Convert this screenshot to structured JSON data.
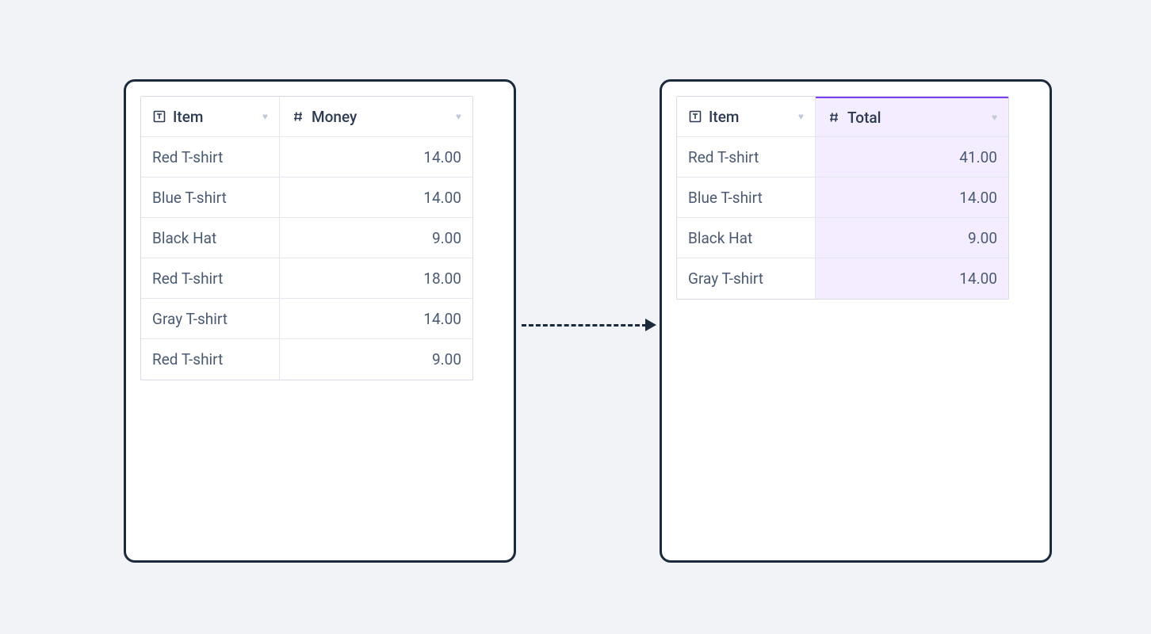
{
  "left_table": {
    "columns": [
      {
        "label": "Item",
        "type": "text"
      },
      {
        "label": "Money",
        "type": "number"
      }
    ],
    "rows": [
      {
        "item": "Red T-shirt",
        "value": "14.00"
      },
      {
        "item": "Blue T-shirt",
        "value": "14.00"
      },
      {
        "item": "Black Hat",
        "value": "9.00"
      },
      {
        "item": "Red T-shirt",
        "value": "18.00"
      },
      {
        "item": "Gray T-shirt",
        "value": "14.00"
      },
      {
        "item": "Red T-shirt",
        "value": "9.00"
      }
    ]
  },
  "right_table": {
    "columns": [
      {
        "label": "Item",
        "type": "text"
      },
      {
        "label": "Total",
        "type": "number",
        "highlighted": true
      }
    ],
    "rows": [
      {
        "item": "Red T-shirt",
        "value": "41.00"
      },
      {
        "item": "Blue T-shirt",
        "value": "14.00"
      },
      {
        "item": "Black Hat",
        "value": "9.00"
      },
      {
        "item": "Gray T-shirt",
        "value": "14.00"
      }
    ]
  }
}
